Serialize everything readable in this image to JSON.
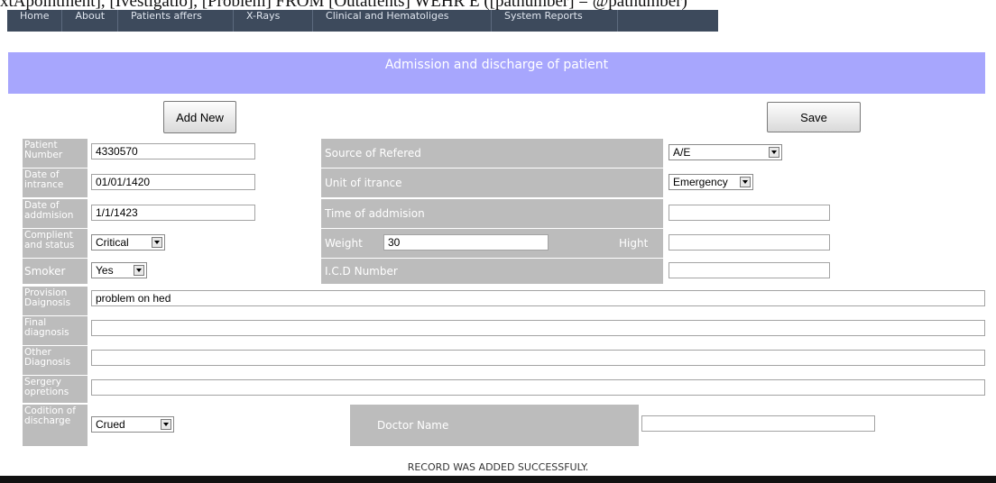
{
  "sql_overlay": "xtApointment], [Ivestigatio], [Problem] FROM [Outatients] WEHR E ([patnumber] = @patnumber)",
  "nav": [
    "Home",
    "About",
    "Patients affers",
    "X-Rays",
    "Clinical and Hematoliges",
    "System Reports"
  ],
  "page_title": "Admission and discharge of patient",
  "buttons": {
    "add_new": "Add New",
    "save": "Save"
  },
  "form": {
    "patient_number": {
      "label": "Patient Number",
      "value": "4330570"
    },
    "date_of_intrance": {
      "label": "Date of intrance",
      "value": "01/01/1420"
    },
    "date_of_addmision": {
      "label": "Date of addmision",
      "value": "1/1/1423"
    },
    "compliant_status": {
      "label": "Complient and status",
      "value": "Critical"
    },
    "smoker": {
      "label": "Smoker",
      "value": "Yes"
    },
    "source_of_refered": {
      "label": "Source of Refered",
      "value": "A/E"
    },
    "unit_of_itrance": {
      "label": "Unit of itrance",
      "value": "Emergency"
    },
    "time_of_addmision": {
      "label": "Time of addmision",
      "value": ""
    },
    "weight": {
      "label": "Weight",
      "value": "30"
    },
    "hight": {
      "label": "Hight",
      "value": ""
    },
    "icd_number": {
      "label": "I.C.D Number",
      "value": ""
    },
    "provision_diagnosis": {
      "label": "Provision Daignosis",
      "value": "problem on hed"
    },
    "final_diagnosis": {
      "label": "Final diagnosis",
      "value": ""
    },
    "other_diagnosis": {
      "label": "Other Diagnosis",
      "value": ""
    },
    "sergery_opretions": {
      "label": "Sergery opretions",
      "value": ""
    },
    "condition_discharge": {
      "label": "Codition of discharge",
      "value": "Crued"
    },
    "doctor_name": {
      "label": "Doctor Name",
      "value": ""
    }
  },
  "status_message": "RECORD WAS ADDED SUCCESSFULY."
}
